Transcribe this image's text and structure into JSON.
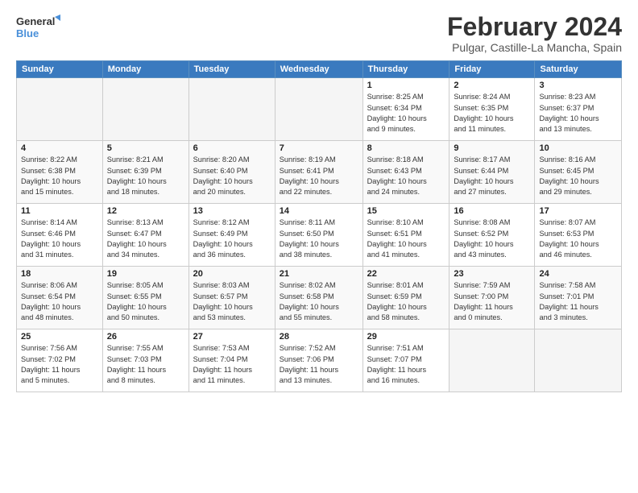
{
  "logo": {
    "line1": "General",
    "line2": "Blue"
  },
  "title": "February 2024",
  "location": "Pulgar, Castille-La Mancha, Spain",
  "weekdays": [
    "Sunday",
    "Monday",
    "Tuesday",
    "Wednesday",
    "Thursday",
    "Friday",
    "Saturday"
  ],
  "weeks": [
    [
      {
        "day": "",
        "info": ""
      },
      {
        "day": "",
        "info": ""
      },
      {
        "day": "",
        "info": ""
      },
      {
        "day": "",
        "info": ""
      },
      {
        "day": "1",
        "info": "Sunrise: 8:25 AM\nSunset: 6:34 PM\nDaylight: 10 hours\nand 9 minutes."
      },
      {
        "day": "2",
        "info": "Sunrise: 8:24 AM\nSunset: 6:35 PM\nDaylight: 10 hours\nand 11 minutes."
      },
      {
        "day": "3",
        "info": "Sunrise: 8:23 AM\nSunset: 6:37 PM\nDaylight: 10 hours\nand 13 minutes."
      }
    ],
    [
      {
        "day": "4",
        "info": "Sunrise: 8:22 AM\nSunset: 6:38 PM\nDaylight: 10 hours\nand 15 minutes."
      },
      {
        "day": "5",
        "info": "Sunrise: 8:21 AM\nSunset: 6:39 PM\nDaylight: 10 hours\nand 18 minutes."
      },
      {
        "day": "6",
        "info": "Sunrise: 8:20 AM\nSunset: 6:40 PM\nDaylight: 10 hours\nand 20 minutes."
      },
      {
        "day": "7",
        "info": "Sunrise: 8:19 AM\nSunset: 6:41 PM\nDaylight: 10 hours\nand 22 minutes."
      },
      {
        "day": "8",
        "info": "Sunrise: 8:18 AM\nSunset: 6:43 PM\nDaylight: 10 hours\nand 24 minutes."
      },
      {
        "day": "9",
        "info": "Sunrise: 8:17 AM\nSunset: 6:44 PM\nDaylight: 10 hours\nand 27 minutes."
      },
      {
        "day": "10",
        "info": "Sunrise: 8:16 AM\nSunset: 6:45 PM\nDaylight: 10 hours\nand 29 minutes."
      }
    ],
    [
      {
        "day": "11",
        "info": "Sunrise: 8:14 AM\nSunset: 6:46 PM\nDaylight: 10 hours\nand 31 minutes."
      },
      {
        "day": "12",
        "info": "Sunrise: 8:13 AM\nSunset: 6:47 PM\nDaylight: 10 hours\nand 34 minutes."
      },
      {
        "day": "13",
        "info": "Sunrise: 8:12 AM\nSunset: 6:49 PM\nDaylight: 10 hours\nand 36 minutes."
      },
      {
        "day": "14",
        "info": "Sunrise: 8:11 AM\nSunset: 6:50 PM\nDaylight: 10 hours\nand 38 minutes."
      },
      {
        "day": "15",
        "info": "Sunrise: 8:10 AM\nSunset: 6:51 PM\nDaylight: 10 hours\nand 41 minutes."
      },
      {
        "day": "16",
        "info": "Sunrise: 8:08 AM\nSunset: 6:52 PM\nDaylight: 10 hours\nand 43 minutes."
      },
      {
        "day": "17",
        "info": "Sunrise: 8:07 AM\nSunset: 6:53 PM\nDaylight: 10 hours\nand 46 minutes."
      }
    ],
    [
      {
        "day": "18",
        "info": "Sunrise: 8:06 AM\nSunset: 6:54 PM\nDaylight: 10 hours\nand 48 minutes."
      },
      {
        "day": "19",
        "info": "Sunrise: 8:05 AM\nSunset: 6:55 PM\nDaylight: 10 hours\nand 50 minutes."
      },
      {
        "day": "20",
        "info": "Sunrise: 8:03 AM\nSunset: 6:57 PM\nDaylight: 10 hours\nand 53 minutes."
      },
      {
        "day": "21",
        "info": "Sunrise: 8:02 AM\nSunset: 6:58 PM\nDaylight: 10 hours\nand 55 minutes."
      },
      {
        "day": "22",
        "info": "Sunrise: 8:01 AM\nSunset: 6:59 PM\nDaylight: 10 hours\nand 58 minutes."
      },
      {
        "day": "23",
        "info": "Sunrise: 7:59 AM\nSunset: 7:00 PM\nDaylight: 11 hours\nand 0 minutes."
      },
      {
        "day": "24",
        "info": "Sunrise: 7:58 AM\nSunset: 7:01 PM\nDaylight: 11 hours\nand 3 minutes."
      }
    ],
    [
      {
        "day": "25",
        "info": "Sunrise: 7:56 AM\nSunset: 7:02 PM\nDaylight: 11 hours\nand 5 minutes."
      },
      {
        "day": "26",
        "info": "Sunrise: 7:55 AM\nSunset: 7:03 PM\nDaylight: 11 hours\nand 8 minutes."
      },
      {
        "day": "27",
        "info": "Sunrise: 7:53 AM\nSunset: 7:04 PM\nDaylight: 11 hours\nand 11 minutes."
      },
      {
        "day": "28",
        "info": "Sunrise: 7:52 AM\nSunset: 7:06 PM\nDaylight: 11 hours\nand 13 minutes."
      },
      {
        "day": "29",
        "info": "Sunrise: 7:51 AM\nSunset: 7:07 PM\nDaylight: 11 hours\nand 16 minutes."
      },
      {
        "day": "",
        "info": ""
      },
      {
        "day": "",
        "info": ""
      }
    ]
  ]
}
